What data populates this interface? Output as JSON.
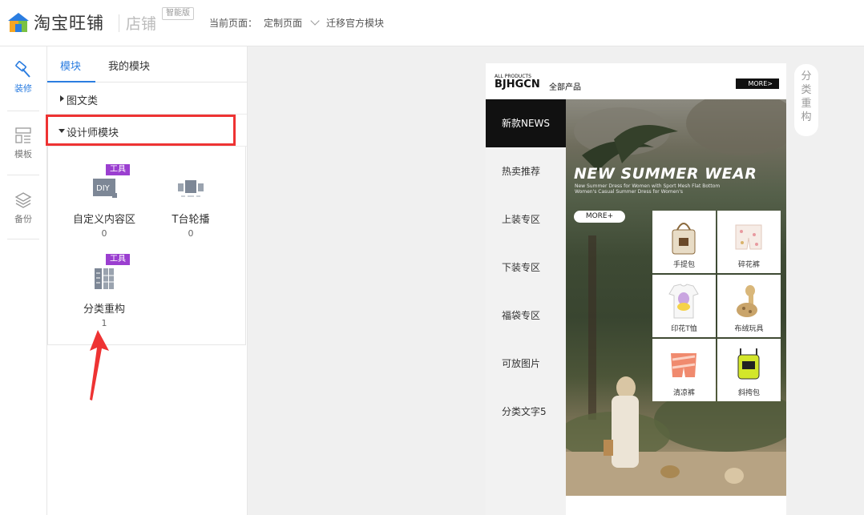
{
  "header": {
    "brand": "淘宝旺铺",
    "sub_brand": "店铺",
    "badge": "智能版",
    "current_page_label": "当前页面：",
    "current_page": "定制页面",
    "migrate": "迁移官方模块"
  },
  "leftnav": [
    {
      "label": "装修",
      "icon": "hammer-icon"
    },
    {
      "label": "模板",
      "icon": "template-icon"
    },
    {
      "label": "备份",
      "icon": "layers-icon"
    }
  ],
  "panel": {
    "tabs": [
      {
        "label": "模块"
      },
      {
        "label": "我的模块"
      }
    ],
    "sections": [
      {
        "label": "图文类"
      },
      {
        "label": "设计师模块"
      }
    ],
    "modules": [
      {
        "name": "自定义内容区",
        "count": "0",
        "tag": "工具",
        "icon_text": "DIY"
      },
      {
        "name": "T台轮播",
        "count": "0"
      },
      {
        "name": "分类重构",
        "count": "1",
        "tag": "工具"
      }
    ]
  },
  "preview": {
    "small_title": "ALL PRODUCTS",
    "big_title": "BJHGCN",
    "cn_title": "全部产品",
    "more": "MORE>",
    "categories": [
      "新款NEWS",
      "热卖推荐",
      "上装专区",
      "下装专区",
      "福袋专区",
      "可放图片",
      "分类文字5"
    ],
    "headline": "NEW SUMMER WEAR",
    "sub1": "New Summer Dress for Women with Sport Mesh Flat Bottom",
    "sub2": "Women's Casual Summer Dress for Women's",
    "more2": "MORE+",
    "products": [
      "手提包",
      "碎花裤",
      "印花T恤",
      "布绒玩具",
      "清凉裤",
      "斜挎包"
    ]
  },
  "side_label": "分类重构",
  "colors": {
    "accent": "#2b7de0",
    "highlight": "#ee3333",
    "tag": "#9b3fd0"
  }
}
